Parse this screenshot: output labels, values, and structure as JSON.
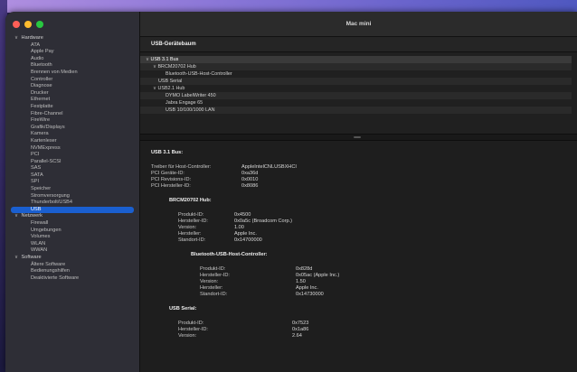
{
  "window": {
    "title": "Mac mini"
  },
  "traffic_lights": [
    {
      "name": "close-button",
      "color": "#ff5f57"
    },
    {
      "name": "minimize-button",
      "color": "#febc2e"
    },
    {
      "name": "zoom-button",
      "color": "#28c840"
    }
  ],
  "sidebar": {
    "sections": [
      {
        "label": "Hardware",
        "items": [
          "ATA",
          "Apple Pay",
          "Audio",
          "Bluetooth",
          "Brennen von Medien",
          "Controller",
          "Diagnose",
          "Drucker",
          "Ethernet",
          "Festplatte",
          "Fibre-Channel",
          "FireWire",
          "Grafik/Displays",
          "Kamera",
          "Kartenleser",
          "NVMExpress",
          "PCI",
          "Parallel-SCSI",
          "SAS",
          "SATA",
          "SPI",
          "Speicher",
          "Stromversorgung",
          "Thunderbolt/USB4",
          "USB"
        ]
      },
      {
        "label": "Netzwerk",
        "items": [
          "Firewall",
          "Umgebungen",
          "Volumes",
          "WLAN",
          "WWAN"
        ]
      },
      {
        "label": "Software",
        "items": [
          "Ältere Software",
          "Bedienungshilfen",
          "Deaktivierte Software"
        ]
      }
    ],
    "selected": "USB"
  },
  "usb_tree": {
    "header": "USB-Gerätebaum",
    "rows": [
      {
        "label": "USB 3.1 Bus",
        "indent": 0,
        "caret": "∨"
      },
      {
        "label": "BRCM20702 Hub",
        "indent": 1,
        "caret": "∨"
      },
      {
        "label": "Bluetooth-USB-Host-Controller",
        "indent": 2,
        "caret": ""
      },
      {
        "label": "USB Serial",
        "indent": 1,
        "caret": ""
      },
      {
        "label": "USB2.1 Hub",
        "indent": 1,
        "caret": "∨"
      },
      {
        "label": "DYMO LabelWriter 450",
        "indent": 2,
        "caret": ""
      },
      {
        "label": "Jabra Engage 65",
        "indent": 2,
        "caret": ""
      },
      {
        "label": "USB 10/100/1000 LAN",
        "indent": 2,
        "caret": ""
      }
    ]
  },
  "detail": {
    "title": "USB 3.1 Bus:",
    "bus_props": [
      {
        "k": "Treiber für Host-Controller:",
        "v": "AppleIntelCNLUSBXHCI"
      },
      {
        "k": "PCI Geräte-ID:",
        "v": "0xa36d"
      },
      {
        "k": "PCI Revisions-ID:",
        "v": "0x0010"
      },
      {
        "k": "PCI Hersteller-ID:",
        "v": "0x8086"
      }
    ],
    "hub": {
      "title": "BRCM20702 Hub:",
      "props": [
        {
          "k": "Produkt-ID:",
          "v": "0x4500"
        },
        {
          "k": "Hersteller-ID:",
          "v": "0x0a5c  (Broadcom Corp.)"
        },
        {
          "k": "Version:",
          "v": "1.00"
        },
        {
          "k": "Hersteller:",
          "v": "Apple Inc."
        },
        {
          "k": "Standort-ID:",
          "v": "0x14700000"
        }
      ]
    },
    "bt": {
      "title": "Bluetooth-USB-Host-Controller:",
      "props": [
        {
          "k": "Produkt-ID:",
          "v": "0x828d"
        },
        {
          "k": "Hersteller-ID:",
          "v": "0x05ac (Apple Inc.)"
        },
        {
          "k": "Version:",
          "v": "1.50"
        },
        {
          "k": "Hersteller:",
          "v": "Apple Inc."
        },
        {
          "k": "Standort-ID:",
          "v": "0x14730000"
        }
      ]
    },
    "serial": {
      "title": "USB Serial:",
      "props": [
        {
          "k": "Produkt-ID:",
          "v": "0x7523"
        },
        {
          "k": "Hersteller-ID:",
          "v": "0x1a86"
        },
        {
          "k": "Version:",
          "v": "2.64"
        }
      ]
    }
  }
}
